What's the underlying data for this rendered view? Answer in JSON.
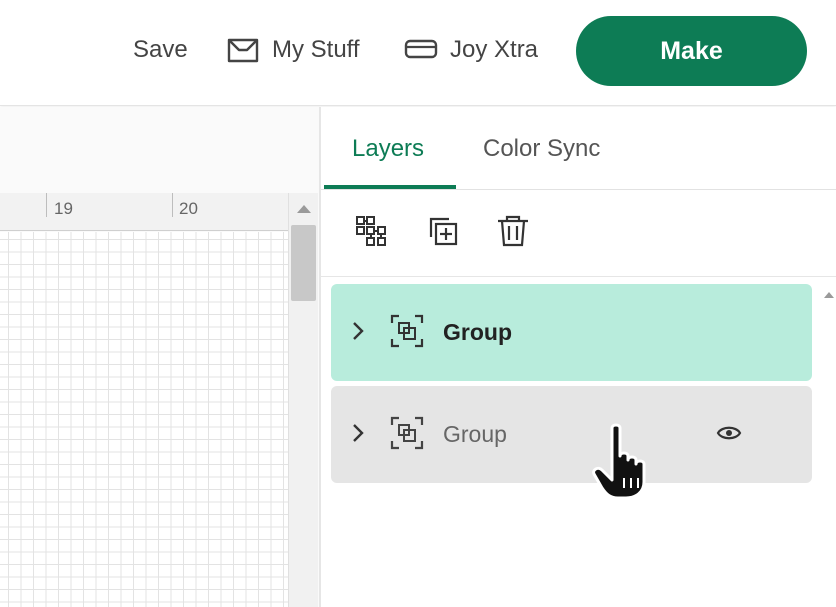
{
  "header": {
    "save_label": "Save",
    "my_stuff_label": "My Stuff",
    "machine_label": "Joy Xtra",
    "make_label": "Make",
    "make_color": "#0d7c55"
  },
  "canvas": {
    "ruler_labels": [
      "19",
      "20"
    ]
  },
  "panel": {
    "tabs": [
      {
        "label": "Layers",
        "active": true
      },
      {
        "label": "Color Sync",
        "active": false
      }
    ],
    "toolbar": {
      "icons": [
        "group-icon",
        "duplicate-icon",
        "delete-icon"
      ]
    },
    "layers": [
      {
        "label": "Group",
        "selected": true,
        "icon": "group-layer-icon"
      },
      {
        "label": "Group",
        "selected": false,
        "icon": "group-layer-icon",
        "visibility_icon": "eye-icon"
      }
    ],
    "selected_color": "#b8ecdc",
    "hover_color": "#e5e5e5"
  },
  "cursor": "hand-pointer-icon"
}
